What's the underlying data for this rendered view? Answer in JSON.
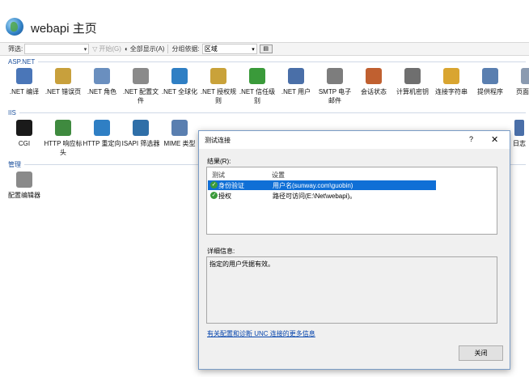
{
  "header": {
    "title": "webapi 主页"
  },
  "toolbar": {
    "filter_label": "筛选:",
    "start_label": "开始(G)",
    "show_all_label": "全部显示(A)",
    "group_by_label": "分组依据:",
    "group_by_value": "区域"
  },
  "sections": {
    "aspnet": "ASP.NET",
    "iis": "IIS",
    "manage": "管理"
  },
  "aspnet_features": [
    {
      "label": ".NET 编译",
      "color": "#4a76b8"
    },
    {
      "label": ".NET 错误页",
      "color": "#c8a03c"
    },
    {
      "label": ".NET 角色",
      "color": "#6a8fbf"
    },
    {
      "label": ".NET 配置文件",
      "color": "#8a8a8a"
    },
    {
      "label": ".NET 全球化",
      "color": "#2f7fc4"
    },
    {
      "label": ".NET 授权规则",
      "color": "#c9a23a"
    },
    {
      "label": ".NET 信任级别",
      "color": "#3a9a3a"
    },
    {
      "label": ".NET 用户",
      "color": "#4a6fa8"
    },
    {
      "label": "SMTP 电子邮件",
      "color": "#7d7d7d"
    },
    {
      "label": "会话状态",
      "color": "#c06030"
    },
    {
      "label": "计算机密钥",
      "color": "#6f6f6f"
    },
    {
      "label": "连接字符串",
      "color": "#d9a530"
    },
    {
      "label": "提供程序",
      "color": "#5a7fb0"
    },
    {
      "label": "页面和控",
      "color": "#8a9ab0"
    }
  ],
  "iis_features": [
    {
      "label": "CGI",
      "color": "#1a1a1a"
    },
    {
      "label": "HTTP 响应标头",
      "color": "#3f8a3f"
    },
    {
      "label": "HTTP 重定向",
      "color": "#2f7fc4"
    },
    {
      "label": "ISAPI 筛选器",
      "color": "#2f6fa8"
    },
    {
      "label": "MIME 类型",
      "color": "#5a7fb0"
    }
  ],
  "iis_partial_label": "日志",
  "manage_features": [
    {
      "label": "配置编辑器",
      "color": "#8a8a8a"
    }
  ],
  "dialog": {
    "title": "测试连接",
    "help": "?",
    "close": "✕",
    "results_label": "结果(R):",
    "col_test": "测试",
    "col_setting": "设置",
    "rows": [
      {
        "test": "身份验证",
        "setting": "用户名(sunway.com\\guobin)"
      },
      {
        "test": "授权",
        "setting": "路径可访问(E:\\Net\\webapi)。"
      }
    ],
    "details_label": "详细信息:",
    "details_text": "指定的用户凭据有效。",
    "help_link": "有关配置和诊断 UNC 连接的更多信息",
    "close_button": "关闭"
  }
}
